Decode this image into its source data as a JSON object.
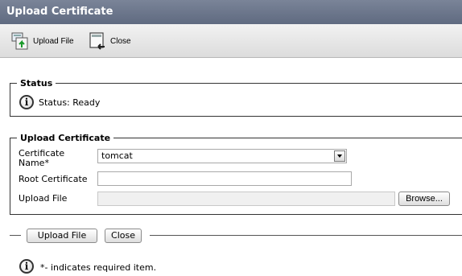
{
  "window": {
    "title": "Upload Certificate"
  },
  "toolbar": {
    "upload_label": "Upload File",
    "close_label": "Close"
  },
  "status": {
    "legend": "Status",
    "text": "Status: Ready"
  },
  "form": {
    "legend": "Upload Certificate",
    "cert_name_label_line1": "Certificate",
    "cert_name_label_line2": "Name",
    "required_marker": "*",
    "cert_name_value": "tomcat",
    "root_cert_label": "Root Certificate",
    "root_cert_value": "",
    "upload_file_label": "Upload File",
    "upload_file_value": "",
    "browse_label": "Browse..."
  },
  "actions": {
    "upload_label": "Upload File",
    "close_label": "Close"
  },
  "footer": {
    "note": "*- indicates required item."
  }
}
